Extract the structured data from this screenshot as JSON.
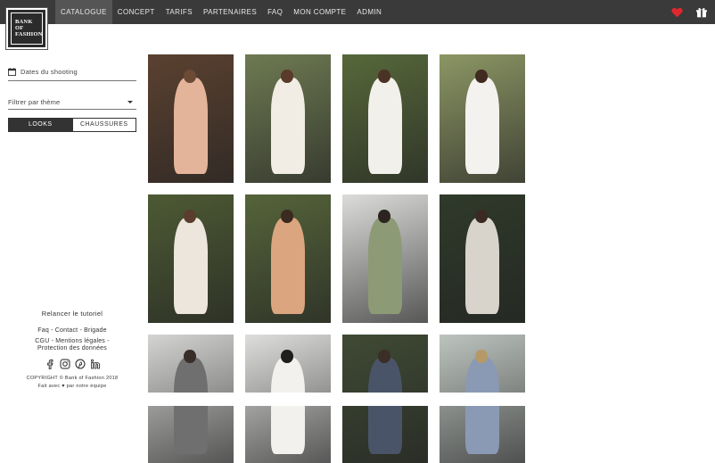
{
  "brand": {
    "logo_lines": [
      "BANK",
      "OF",
      "FASHION"
    ]
  },
  "nav": {
    "items": [
      "CATALOGUE",
      "CONCEPT",
      "TARIFS",
      "PARTENAIRES",
      "FAQ",
      "MON COMPTE",
      "ADMIN"
    ],
    "active": "CATALOGUE"
  },
  "header_icons": [
    "heart-icon",
    "gift-icon"
  ],
  "filters": {
    "date_placeholder": "Dates du shooting",
    "theme_placeholder": "Filtrer par thème",
    "toggle": {
      "left": "LOOKS",
      "right": "CHAUSSURES",
      "selected": "LOOKS"
    }
  },
  "footer": {
    "tutorial": "Relancer le tutoriel",
    "links_line1": [
      "Faq",
      "Contact",
      "Brigade"
    ],
    "links_line2": [
      "CGU",
      "Mentions légales"
    ],
    "links_line3": "Protection des données",
    "socials": [
      "facebook-icon",
      "instagram-icon",
      "pinterest-icon",
      "linkedin-icon"
    ],
    "copyright": "COPYRIGHT © Bank of Fashion 2018",
    "made_with": "Fait avec ♥ par notre équipe"
  },
  "colors": {
    "topbar": "#3a3a3a",
    "active_tab": "#555555",
    "heart": "#e0282e"
  },
  "catalogue": {
    "photos": [
      {
        "bg": "#5b4130",
        "fig": "#e4b49a",
        "head": "#6b4a36"
      },
      {
        "bg": "#6e7a52",
        "fig": "#f1ede4",
        "head": "#5a3a2a"
      },
      {
        "bg": "#56683a",
        "fig": "#f2f0ea",
        "head": "#4a3324"
      },
      {
        "bg": "#8c9664",
        "fig": "#f4f2ee",
        "head": "#3f2b20"
      },
      {
        "bg": "#4d5a34",
        "fig": "#ece6dc",
        "head": "#5a3d2c"
      },
      {
        "bg": "#55643a",
        "fig": "#dba67f",
        "head": "#3b2a20"
      },
      {
        "bg": "#dcdcda",
        "fig": "#8d9a76",
        "head": "#2c2420"
      },
      {
        "bg": "#2f3a2a",
        "fig": "#d8d4cc",
        "head": "#3a2a22"
      },
      {
        "bg": "#d4d4d2",
        "fig": "#6f6f70",
        "head": "#3a2e28"
      },
      {
        "bg": "#dededc",
        "fig": "#f3f1ed",
        "head": "#1e1e1e"
      },
      {
        "bg": "#3f4a34",
        "fig": "#4a5468",
        "head": "#3a2e26"
      },
      {
        "bg": "#bdc4bf",
        "fig": "#8a9ab4",
        "head": "#b59a68"
      }
    ]
  }
}
